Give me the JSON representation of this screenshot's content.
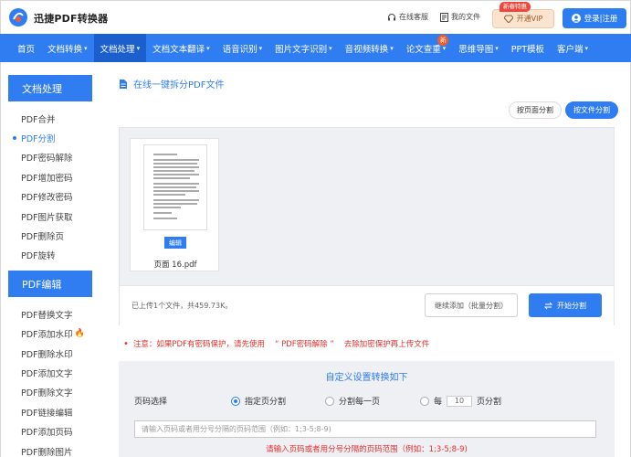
{
  "header": {
    "brand": "迅捷PDF转换器",
    "links": [
      {
        "icon": "headset-icon",
        "label": "在线客服"
      },
      {
        "icon": "document-icon",
        "label": "我的文件"
      }
    ],
    "vip_badge": "新春特惠",
    "vip_label": "开通VIP",
    "login_label": "登录|注册"
  },
  "nav": {
    "items": [
      {
        "label": "首页",
        "dropdown": false,
        "active": false
      },
      {
        "label": "文档转换",
        "dropdown": true,
        "active": false
      },
      {
        "label": "文档处理",
        "dropdown": true,
        "active": true
      },
      {
        "label": "文档文本翻译",
        "dropdown": true,
        "active": false
      },
      {
        "label": "语音识别",
        "dropdown": true,
        "active": false
      },
      {
        "label": "图片文字识别",
        "dropdown": true,
        "active": false
      },
      {
        "label": "音视频转换",
        "dropdown": true,
        "active": false
      },
      {
        "label": "论文查重",
        "dropdown": true,
        "active": false,
        "badge": "新"
      },
      {
        "label": "思维导图",
        "dropdown": true,
        "active": false
      },
      {
        "label": "PPT模板",
        "dropdown": false,
        "active": false
      },
      {
        "label": "客户端",
        "dropdown": true,
        "active": false
      }
    ]
  },
  "sidebar": {
    "section1_title": "文档处理",
    "section1_items": [
      "PDF合并",
      "PDF分割",
      "PDF密码解除",
      "PDF增加密码",
      "PDF修改密码",
      "PDF图片获取",
      "PDF删除页",
      "PDF旋转"
    ],
    "section2_title": "PDF编辑",
    "section2_items": [
      "PDF替换文字",
      "PDF添加水印",
      "PDF删除水印",
      "PDF添加文字",
      "PDF删除文字",
      "PDF链接编辑",
      "PDF添加页码",
      "PDF删除图片"
    ]
  },
  "main": {
    "title": "在线一键拆分PDF文件",
    "toggle": [
      "按页面分割",
      "按文件分割"
    ],
    "file": {
      "edit_label": "编辑",
      "name": "页面 16.pdf"
    },
    "upload_info": "已上传1个文件，共459.73K。",
    "add_more": "继续添加（批量分割）",
    "start": "开始分割",
    "notice_prefix": "注意：如果PDF有密码保护，请先使用",
    "notice_highlight": "“ PDF密码解除 ”",
    "notice_suffix": "去除加密保护再上传文件",
    "settings_title": "自定义设置转换如下",
    "page_select_label": "页码选择",
    "radio_specified": "指定页分割",
    "radio_each": "分割每一页",
    "radio_every_prefix": "每",
    "radio_every_value": "10",
    "radio_every_suffix": "页分割",
    "range_placeholder": "请输入页码或者用分号分隔的页码范围（例如：1;3-5;8-9)",
    "range_error": "请输入页码或者用分号分隔的页码范围（例如：1;3-5;8-9)"
  },
  "colors": {
    "primary": "#2f7df0",
    "danger": "#e5302d",
    "vip": "#fbe4cf"
  }
}
